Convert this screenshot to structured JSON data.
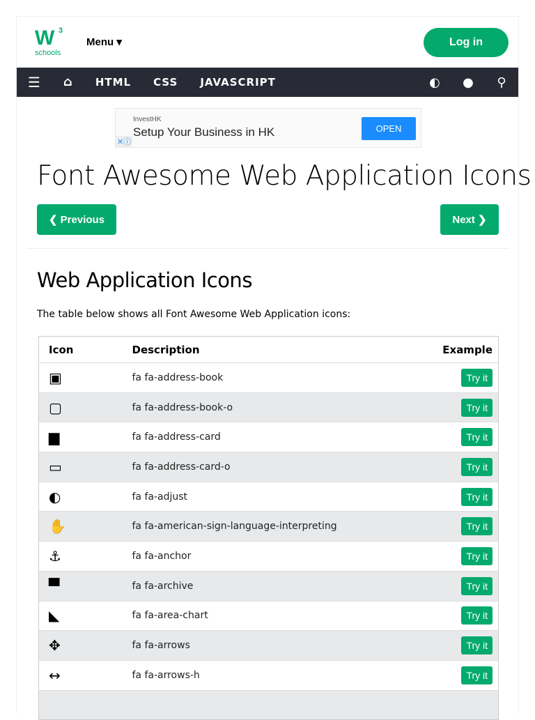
{
  "header": {
    "logo_mark": "W",
    "logo_sup": "3",
    "logo_text": "schools",
    "menu": "Menu ▾",
    "login": "Log in"
  },
  "nav": {
    "items": [
      "HTML",
      "CSS",
      "JAVASCRIPT"
    ]
  },
  "ad": {
    "brand": "InvestHK",
    "headline": "Setup Your Business in HK",
    "cta": "OPEN",
    "close": "✕ⓘ"
  },
  "title": "Font Awesome Web Application Icons",
  "prev": "❮ Previous",
  "next": "Next ❯",
  "section_title": "Web Application Icons",
  "intro": "The table below shows all Font Awesome Web Application icons:",
  "table": {
    "headers": [
      "Icon",
      "Description",
      "Example"
    ],
    "rows": [
      {
        "icon": "▣",
        "desc": "fa fa-address-book",
        "btn": "Try it"
      },
      {
        "icon": "▢",
        "desc": "fa fa-address-book-o",
        "btn": "Try it"
      },
      {
        "icon": "▆",
        "desc": "fa fa-address-card",
        "btn": "Try it"
      },
      {
        "icon": "▭",
        "desc": "fa fa-address-card-o",
        "btn": "Try it"
      },
      {
        "icon": "◐",
        "desc": "fa fa-adjust",
        "btn": "Try it"
      },
      {
        "icon": "✋",
        "desc": "fa fa-american-sign-language-interpreting",
        "btn": "Try it"
      },
      {
        "icon": "⚓",
        "desc": "fa fa-anchor",
        "btn": "Try it"
      },
      {
        "icon": "▀",
        "desc": "fa fa-archive",
        "btn": "Try it"
      },
      {
        "icon": "◣",
        "desc": "fa fa-area-chart",
        "btn": "Try it"
      },
      {
        "icon": "✥",
        "desc": "fa fa-arrows",
        "btn": "Try it"
      },
      {
        "icon": "↔",
        "desc": "fa fa-arrows-h",
        "btn": "Try it"
      },
      {
        "icon": "",
        "desc": "",
        "btn": ""
      }
    ]
  }
}
